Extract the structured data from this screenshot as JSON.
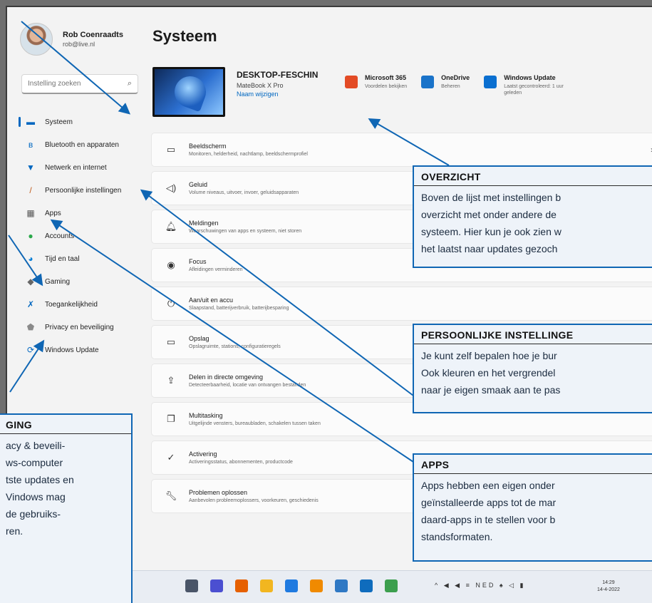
{
  "profile": {
    "name": "Rob Coenraadts",
    "email": "rob@live.nl"
  },
  "search": {
    "placeholder": "Instelling zoeken"
  },
  "nav": [
    {
      "label": "Systeem",
      "icon": "monitor-icon",
      "glyph": "▬",
      "color": "#0067c0",
      "active": true
    },
    {
      "label": "Bluetooth en apparaten",
      "icon": "bluetooth-icon",
      "glyph": "ʙ",
      "color": "#0067c0"
    },
    {
      "label": "Netwerk en internet",
      "icon": "wifi-icon",
      "glyph": "▼",
      "color": "#0067c0"
    },
    {
      "label": "Persoonlijke instellingen",
      "icon": "brush-icon",
      "glyph": "/",
      "color": "#c05a1b"
    },
    {
      "label": "Apps",
      "icon": "apps-icon",
      "glyph": "▦",
      "color": "#555555"
    },
    {
      "label": "Accounts",
      "icon": "person-icon",
      "glyph": "●",
      "color": "#2aa84a"
    },
    {
      "label": "Tijd en taal",
      "icon": "globe-icon",
      "glyph": "◕",
      "color": "#0a7fd6"
    },
    {
      "label": "Gaming",
      "icon": "controller-icon",
      "glyph": "◆",
      "color": "#666666"
    },
    {
      "label": "Toegankelijkheid",
      "icon": "accessibility-icon",
      "glyph": "✗",
      "color": "#0067c0"
    },
    {
      "label": "Privacy en beveiliging",
      "icon": "shield-icon",
      "glyph": "⬟",
      "color": "#8a8a8a"
    },
    {
      "label": "Windows Update",
      "icon": "update-icon",
      "glyph": "⟳",
      "color": "#0067c0"
    }
  ],
  "main": {
    "title": "Systeem",
    "device": {
      "name": "DESKTOP-FESCHIN",
      "model": "MateBook X Pro",
      "rename": "Naam wijzigen"
    },
    "tiles": [
      {
        "title": "Microsoft 365",
        "sub": "Voordelen bekijken",
        "icon": "microsoft-365-icon",
        "color": "#e34b25"
      },
      {
        "title": "OneDrive",
        "sub": "Beheren",
        "icon": "onedrive-icon",
        "color": "#1a73c9"
      },
      {
        "title": "Windows Update",
        "sub": "Laatst gecontroleerd: 1 uur geleden",
        "icon": "windows-update-icon",
        "color": "#0a6fd0"
      }
    ],
    "rows": [
      {
        "title": "Beeldscherm",
        "sub": "Monitoren, helderheid, nachtlamp, beeldschermprofiel",
        "icon": "display-icon",
        "glyph": "▭"
      },
      {
        "title": "Geluid",
        "sub": "Volume niveaus, uitvoer, invoer, geluidsapparaten",
        "icon": "speaker-icon",
        "glyph": "◁)"
      },
      {
        "title": "Meldingen",
        "sub": "Waarschuwingen van apps en systeem, niet storen",
        "icon": "bell-icon",
        "glyph": "🔔︎"
      },
      {
        "title": "Focus",
        "sub": "Afleidingen verminderen",
        "icon": "focus-icon",
        "glyph": "◉"
      },
      {
        "title": "Aan/uit en accu",
        "sub": "Slaapstand, batterijverbruik, batterijbesparing",
        "icon": "power-icon",
        "glyph": "⏻"
      },
      {
        "title": "Opslag",
        "sub": "Opslagruimte, stations, configuratieregels",
        "icon": "storage-icon",
        "glyph": "▭"
      },
      {
        "title": "Delen in directe omgeving",
        "sub": "Detecteerbaarheid, locatie van ontvangen bestanden",
        "icon": "share-icon",
        "glyph": "⇪"
      },
      {
        "title": "Multitasking",
        "sub": "Uitgelijnde vensters, bureaubladen, schakelen tussen taken",
        "icon": "multitasking-icon",
        "glyph": "❐"
      },
      {
        "title": "Activering",
        "sub": "Activeringsstatus, abonnementen, productcode",
        "icon": "check-circle-icon",
        "glyph": "✓"
      },
      {
        "title": "Problemen oplossen",
        "sub": "Aanbevolen probleemoplossers, voorkeuren, geschiedenis",
        "icon": "wrench-icon",
        "glyph": "🔧︎"
      }
    ]
  },
  "callouts": {
    "overzicht": {
      "title": "OVERZICHT",
      "lines": [
        "Boven de lijst met instellingen b",
        "overzicht met onder andere de",
        "systeem. Hier kun je ook zien w",
        "het laatst naar updates gezoch"
      ]
    },
    "persoonlijk": {
      "title": "PERSOONLIJKE INSTELLINGE",
      "lines": [
        "Je kunt zelf bepalen hoe je bur",
        "Ook kleuren en het vergrendel",
        "naar je eigen smaak aan te pas"
      ]
    },
    "apps": {
      "title": "APPS",
      "lines": [
        "Apps hebben een eigen onder",
        "geïnstalleerde apps tot de mar",
        "daard-apps in te stellen voor b",
        "standsformaten."
      ]
    },
    "privacy": {
      "title": "GING",
      "lines": [
        "acy & beveili-",
        "ws-computer",
        "tste updates en",
        "Vindows mag",
        "de gebruiks-",
        "ren."
      ]
    }
  },
  "taskbar": {
    "icons": [
      {
        "name": "taskbar-app-icon",
        "color": "#4a5568"
      },
      {
        "name": "taskbar-chat-icon",
        "color": "#4b4fd1"
      },
      {
        "name": "taskbar-firefox-icon",
        "color": "#e66000"
      },
      {
        "name": "taskbar-explorer-icon",
        "color": "#f2b620"
      },
      {
        "name": "taskbar-store-icon",
        "color": "#1f7ae0"
      },
      {
        "name": "taskbar-vlc-icon",
        "color": "#f08a00"
      },
      {
        "name": "taskbar-settings-icon",
        "color": "#2f78c4"
      },
      {
        "name": "taskbar-mail-icon",
        "color": "#0f6cbd"
      },
      {
        "name": "taskbar-chrome-icon",
        "color": "#3c9f4e"
      }
    ],
    "tray": "^ ◀ ◀ ≡ NED ♠ ◁ ▮",
    "time": "14:29",
    "date": "14-4-2022"
  }
}
